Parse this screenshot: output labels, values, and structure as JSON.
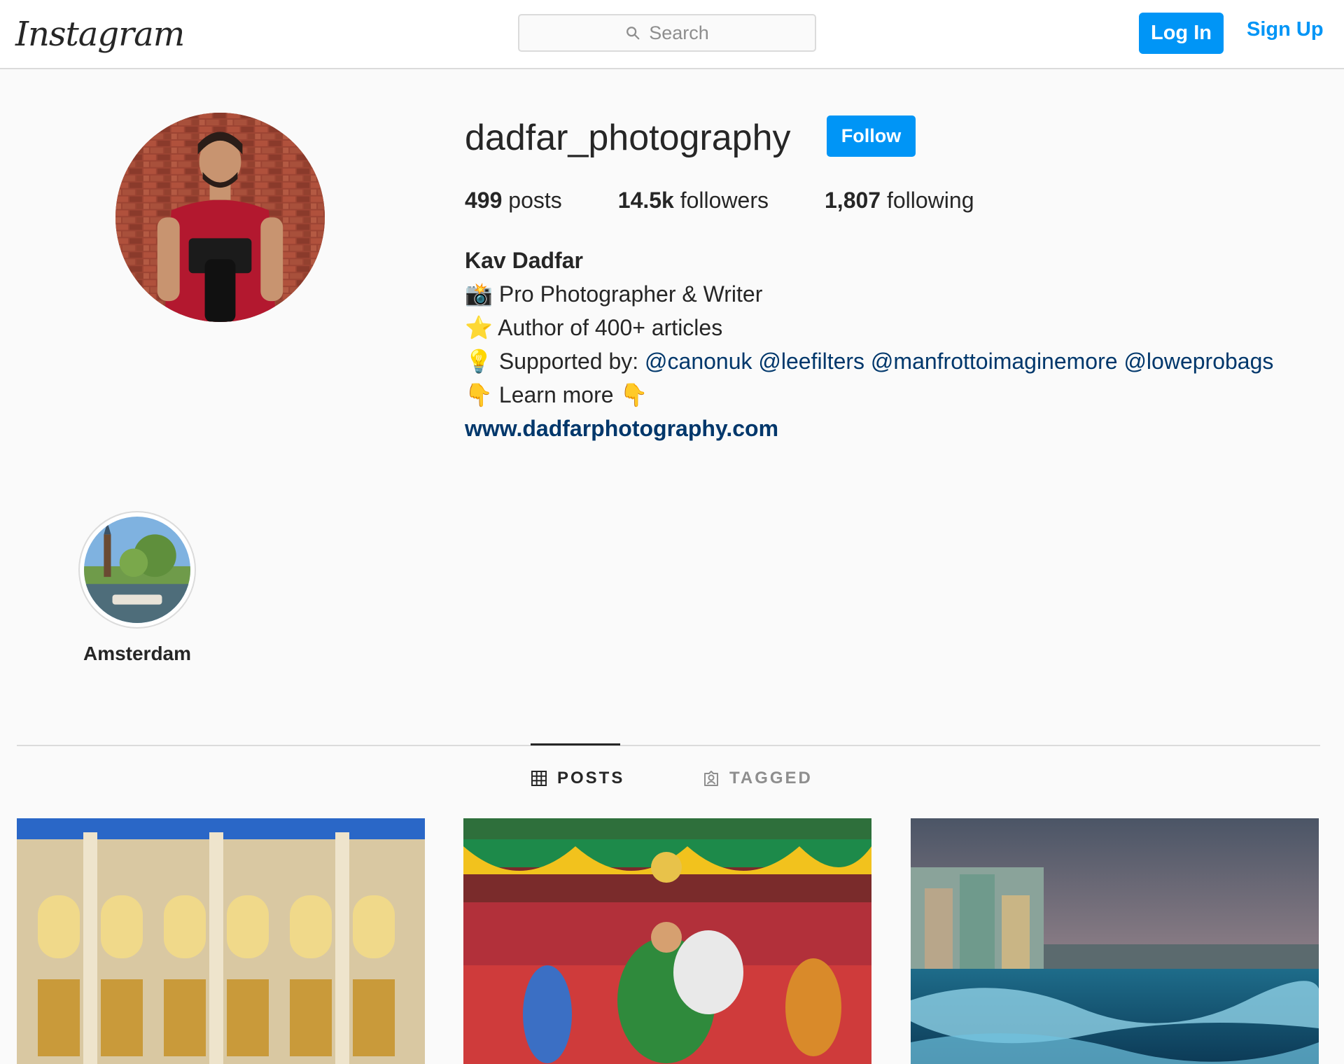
{
  "header": {
    "logo_text": "Instagram",
    "search_placeholder": "Search",
    "login_label": "Log In",
    "signup_label": "Sign Up"
  },
  "profile": {
    "username": "dadfar_photography",
    "follow_label": "Follow",
    "stats": [
      {
        "value": "499",
        "label": "posts"
      },
      {
        "value": "14.5k",
        "label": "followers"
      },
      {
        "value": "1,807",
        "label": "following"
      }
    ],
    "full_name": "Kav Dadfar",
    "bio": {
      "line1_emoji": "📸",
      "line1_text": "Pro Photographer & Writer",
      "line2_emoji": "⭐",
      "line2_text": "Author of 400+ articles",
      "line3_emoji": "💡",
      "line3_text": "Supported by:",
      "mentions": [
        "@canonuk",
        "@leefilters",
        "@manfrottoimaginemore",
        "@loweprobags"
      ],
      "line4_emoji_left": "👇",
      "line4_text": "Learn more",
      "line4_emoji_right": "👇"
    },
    "website": "www.dadfarphotography.com"
  },
  "highlights": [
    {
      "label": "Amsterdam"
    }
  ],
  "tabs": [
    {
      "label": "POSTS",
      "active": true,
      "icon": "grid-icon"
    },
    {
      "label": "TAGGED",
      "active": false,
      "icon": "tagged-user-icon"
    }
  ],
  "colors": {
    "accent": "#0095f6",
    "link": "#00376b",
    "text": "#262626",
    "muted": "#8e8e8e",
    "border": "#dbdbdb",
    "background": "#fafafa"
  }
}
